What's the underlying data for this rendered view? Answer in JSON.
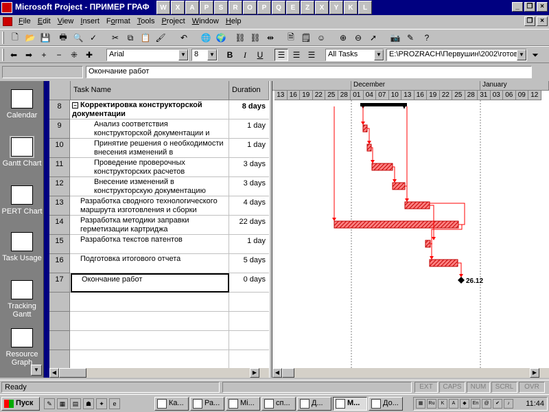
{
  "window": {
    "title": "Microsoft Project - ПРИМЕР ГРАФ"
  },
  "quick_strip": [
    "W",
    "X",
    "A",
    "P",
    "S",
    "R",
    "O",
    "P",
    "Q",
    "E",
    "Z",
    "X",
    "Y",
    "K",
    "L"
  ],
  "menu": [
    {
      "label": "File",
      "u": "F",
      "rest": "ile"
    },
    {
      "label": "Edit",
      "u": "E",
      "rest": "dit"
    },
    {
      "label": "View",
      "u": "V",
      "rest": "iew"
    },
    {
      "label": "Insert",
      "u": "I",
      "rest": "nsert"
    },
    {
      "label": "Format",
      "pre": "F",
      "u": "o",
      "rest": "rmat"
    },
    {
      "label": "Tools",
      "u": "T",
      "rest": "ools"
    },
    {
      "label": "Project",
      "u": "P",
      "rest": "roject"
    },
    {
      "label": "Window",
      "u": "W",
      "rest": "indow"
    },
    {
      "label": "Help",
      "u": "H",
      "rest": "elp"
    }
  ],
  "formatting": {
    "font": "Arial",
    "size": "8",
    "filter": "All Tasks",
    "path": "E:\\PROZRACH\\Первушин\\2002\\готов"
  },
  "entry_bar": {
    "value": "Окончание работ"
  },
  "view_bar": [
    {
      "label": "Calendar",
      "icon": "calendar-icon"
    },
    {
      "label": "Gantt Chart",
      "icon": "gantt-chart-icon",
      "selected": true
    },
    {
      "label": "PERT Chart",
      "icon": "pert-chart-icon"
    },
    {
      "label": "Task Usage",
      "icon": "task-usage-icon"
    },
    {
      "label": "Tracking Gantt",
      "icon": "tracking-gantt-icon"
    },
    {
      "label": "Resource Graph",
      "icon": "resource-graph-icon"
    }
  ],
  "table": {
    "columns": {
      "name": "Task Name",
      "duration": "Duration"
    },
    "rows": [
      {
        "id": "8",
        "name": "Корректировка конструкторской документации",
        "duration": "8 days",
        "summary": true
      },
      {
        "id": "9",
        "name": "Анализ соответствия конструкторской документации и",
        "duration": "1 day",
        "indent": 2
      },
      {
        "id": "10",
        "name": "Принятие решения о необходимости внесения изменений в",
        "duration": "1 day",
        "indent": 2
      },
      {
        "id": "11",
        "name": "Проведение проверочных конструкторских расчетов",
        "duration": "3 days",
        "indent": 2
      },
      {
        "id": "12",
        "name": "Внесение изменений в конструкторскую документацию",
        "duration": "3 days",
        "indent": 2
      },
      {
        "id": "13",
        "name": "Разработка сводного технологического маршрута изготовления и сборки",
        "duration": "4 days",
        "indent": 1
      },
      {
        "id": "14",
        "name": "Разработка методики заправки герметизации картриджа",
        "duration": "22 days",
        "indent": 1
      },
      {
        "id": "15",
        "name": "Разработка текстов патентов",
        "duration": "1 day",
        "indent": 1
      },
      {
        "id": "16",
        "name": "Подготовка итогового отчета",
        "duration": "5 days",
        "indent": 1
      },
      {
        "id": "17",
        "name": "Окончание работ",
        "duration": "0 days",
        "indent": 1,
        "selected": true
      },
      {
        "id": "",
        "name": "",
        "duration": ""
      },
      {
        "id": "",
        "name": "",
        "duration": ""
      },
      {
        "id": "",
        "name": "",
        "duration": ""
      },
      {
        "id": "",
        "name": "",
        "duration": ""
      }
    ]
  },
  "timescale": {
    "months": [
      {
        "label": "December"
      },
      {
        "label": "January"
      }
    ],
    "days": [
      "13",
      "16",
      "19",
      "22",
      "25",
      "28",
      "01",
      "04",
      "07",
      "10",
      "13",
      "16",
      "19",
      "22",
      "25",
      "28",
      "31",
      "03",
      "06",
      "09",
      "12"
    ]
  },
  "milestone_label": "26.12",
  "status": {
    "ready": "Ready",
    "indicators": [
      "EXT",
      "CAPS",
      "NUM",
      "SCRL",
      "OVR"
    ]
  },
  "taskbar": {
    "start": "Пуск",
    "tasks": [
      {
        "label": "Ка..."
      },
      {
        "label": "Ра..."
      },
      {
        "label": "Mi..."
      },
      {
        "label": "сп..."
      },
      {
        "label": "Д..."
      },
      {
        "label": "М...",
        "active": true
      },
      {
        "label": "До..."
      }
    ],
    "clock": "11:44"
  }
}
